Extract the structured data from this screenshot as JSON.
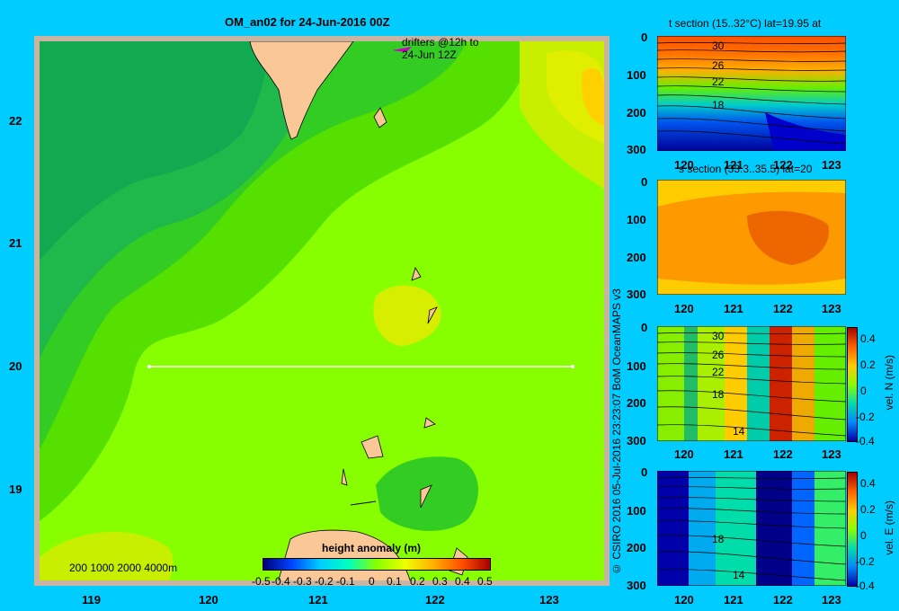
{
  "chart_data": [
    {
      "type": "heatmap",
      "title": "OM_an02 for 24-Jun-2016 00Z",
      "xlim": [
        118.5,
        123.5
      ],
      "ylim": [
        18.2,
        22.7
      ],
      "x_ticks": [
        "119",
        "120",
        "121",
        "122",
        "123"
      ],
      "y_ticks": [
        "19",
        "20",
        "21",
        "22"
      ],
      "annotation": [
        "drifters @12h to",
        "24-Jun 12Z"
      ],
      "depth_legend": "200  1000  2000  4000m",
      "section_line": {
        "lon": [
          119.5,
          123.2
        ],
        "lat": 20
      },
      "colorbar": {
        "label": "height anomaly (m)",
        "range": [
          -0.5,
          0.5
        ],
        "tick_labels": [
          "-0.5",
          "-0.4",
          "-0.3",
          "-0.2",
          "-0.1",
          "0",
          "0.1",
          "0.2",
          "0.3",
          "0.4",
          "0.5"
        ]
      }
    },
    {
      "type": "heatmap",
      "title": "t section (15..32°C) lat=19.95 at",
      "xlim": [
        119.5,
        123.3
      ],
      "ylim": [
        300,
        0
      ],
      "x_ticks": [
        "120",
        "121",
        "122",
        "123"
      ],
      "y_ticks": [
        "0",
        "100",
        "200",
        "300"
      ],
      "contour_labels": [
        "30",
        "26",
        "22",
        "18"
      ]
    },
    {
      "type": "heatmap",
      "title": "s section (33.3..35.5) lat=20",
      "xlim": [
        119.5,
        123.3
      ],
      "ylim": [
        300,
        0
      ],
      "x_ticks": [
        "120",
        "121",
        "122",
        "123"
      ],
      "y_ticks": [
        "0",
        "100",
        "200",
        "300"
      ]
    },
    {
      "type": "heatmap",
      "xlim": [
        119.5,
        123.3
      ],
      "ylim": [
        300,
        0
      ],
      "x_ticks": [
        "120",
        "121",
        "122",
        "123"
      ],
      "y_ticks": [
        "0",
        "100",
        "200",
        "300"
      ],
      "contour_labels": [
        "30",
        "26",
        "22",
        "18",
        "14"
      ],
      "colorbar": {
        "label": "vel. N (m/s)",
        "range": [
          -0.4,
          0.4
        ],
        "tick_labels": [
          "0.4",
          "0.2",
          "0",
          "-0.2",
          "-0.4"
        ]
      }
    },
    {
      "type": "heatmap",
      "xlim": [
        119.5,
        123.3
      ],
      "ylim": [
        300,
        0
      ],
      "x_ticks": [
        "120",
        "121",
        "122",
        "123"
      ],
      "y_ticks": [
        "0",
        "100",
        "200",
        "300"
      ],
      "contour_labels": [
        "18",
        "14"
      ],
      "colorbar": {
        "label": "vel. E (m/s)",
        "range": [
          -0.4,
          0.4
        ],
        "tick_labels": [
          "0.4",
          "0.2",
          "0",
          "-0.2",
          "-0.4"
        ]
      }
    }
  ],
  "credit": "© CSIRO 2016   05-Jul-2016 23:23:07 BoM OceanMAPS v3",
  "colors": {
    "background": "#00ccff",
    "land": "#fac896",
    "frame": "#c8b4a0"
  }
}
